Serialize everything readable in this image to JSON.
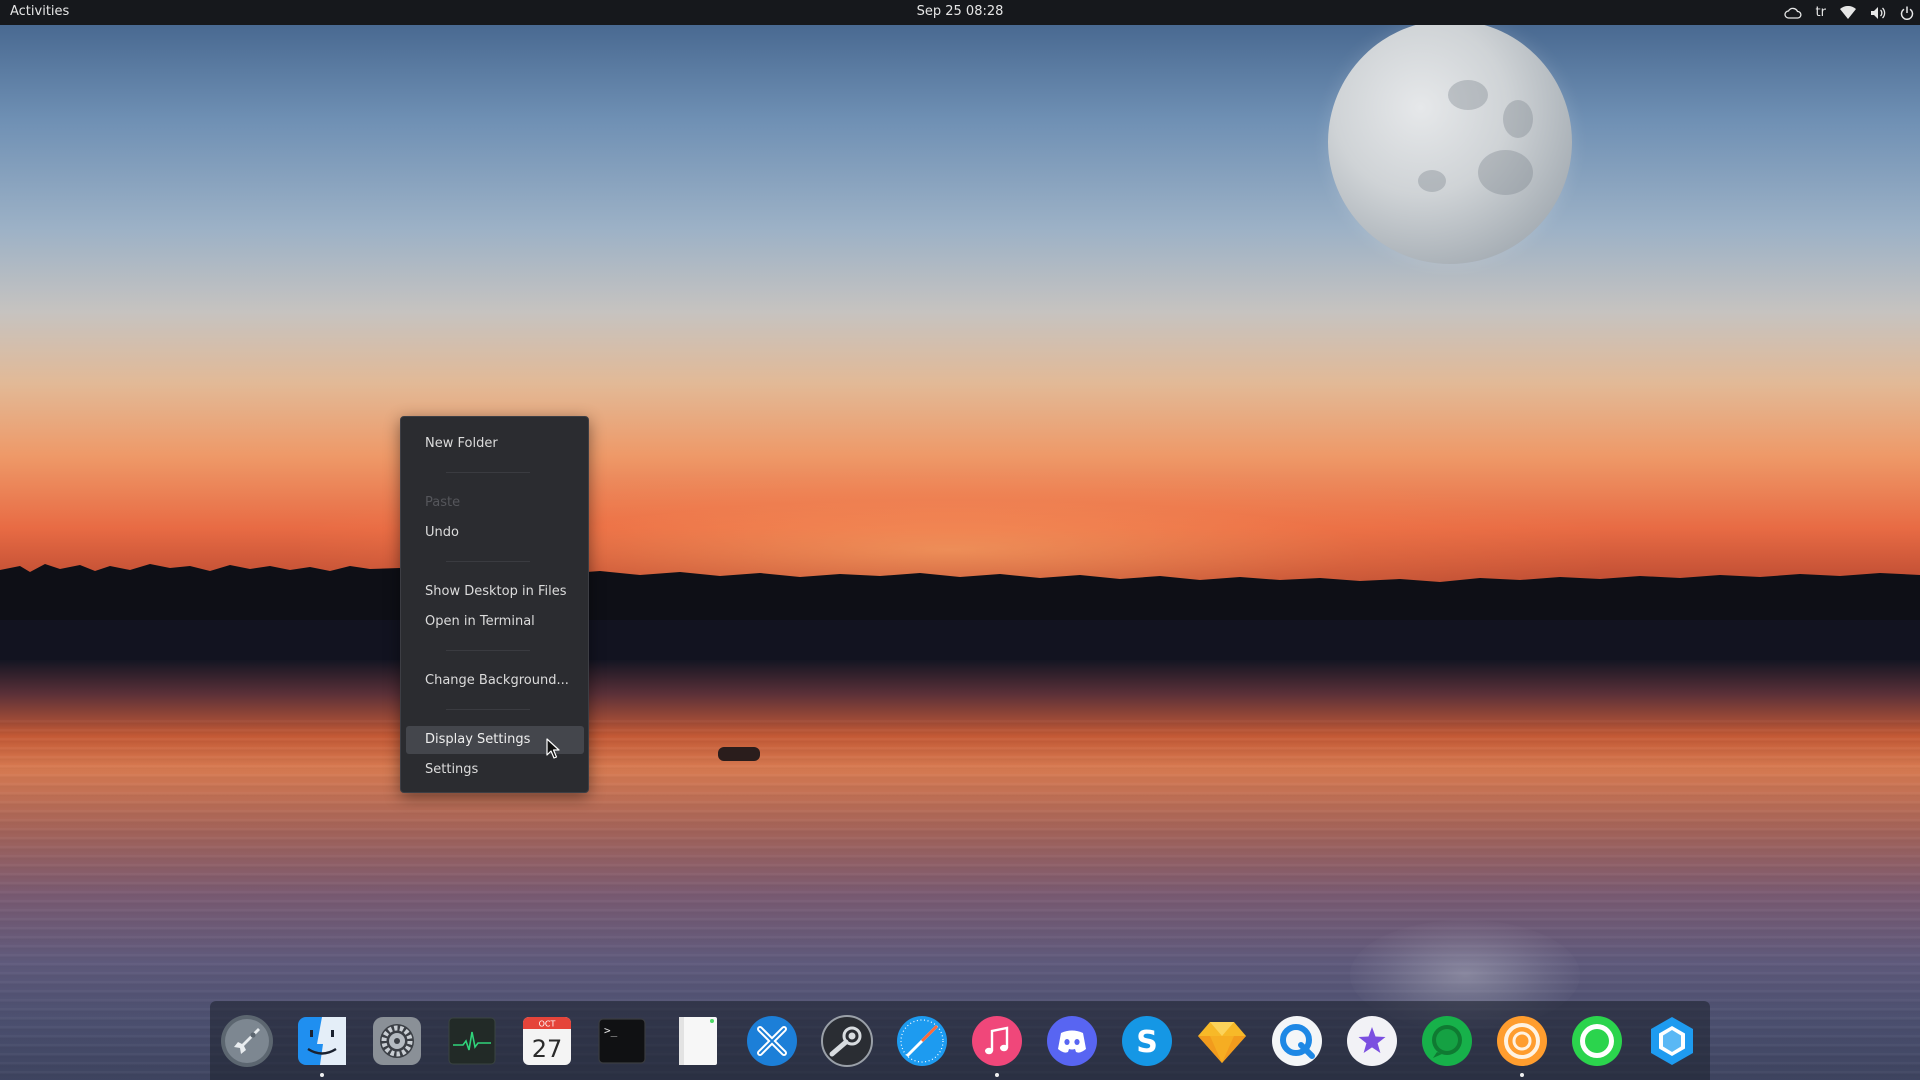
{
  "topbar": {
    "activities_label": "Activities",
    "clock": "Sep 25  08:28",
    "keyboard_layout": "tr",
    "tray_icons": [
      "cloud-icon",
      "keyboard-layout-indicator",
      "wifi-icon",
      "volume-icon",
      "power-icon"
    ]
  },
  "context_menu": {
    "items": [
      {
        "label": "New Folder",
        "state": "enabled"
      },
      {
        "label": "Paste",
        "state": "disabled"
      },
      {
        "label": "Undo",
        "state": "enabled"
      },
      {
        "label": "Show Desktop in Files",
        "state": "enabled"
      },
      {
        "label": "Open in Terminal",
        "state": "enabled"
      },
      {
        "label": "Change Background...",
        "state": "enabled"
      },
      {
        "label": "Display Settings",
        "state": "hovered"
      },
      {
        "label": "Settings",
        "state": "enabled"
      }
    ]
  },
  "dock": {
    "apps": [
      {
        "icon": "rocket-launcher-icon",
        "running": false
      },
      {
        "icon": "finder-files-icon",
        "running": true
      },
      {
        "icon": "system-settings-gear-icon",
        "running": false
      },
      {
        "icon": "system-monitor-icon",
        "running": false
      },
      {
        "icon": "calendar-icon",
        "running": false,
        "month": "OCT",
        "day": "27"
      },
      {
        "icon": "terminal-icon",
        "running": false,
        "prompt": ">_"
      },
      {
        "icon": "text-editor-icon",
        "running": false
      },
      {
        "icon": "xcode-x-icon",
        "running": false
      },
      {
        "icon": "steam-icon",
        "running": false
      },
      {
        "icon": "safari-compass-icon",
        "running": false
      },
      {
        "icon": "music-icon",
        "running": true
      },
      {
        "icon": "discord-icon",
        "running": false
      },
      {
        "icon": "skype-icon",
        "running": false,
        "glyph": "S"
      },
      {
        "icon": "sketch-diamond-icon",
        "running": false
      },
      {
        "icon": "quicktime-q-icon",
        "running": false
      },
      {
        "icon": "star-app-icon",
        "running": false
      },
      {
        "icon": "green-chat-icon",
        "running": false
      },
      {
        "icon": "orange-ring-icon",
        "running": true
      },
      {
        "icon": "green-circle-icon",
        "running": false
      },
      {
        "icon": "blue-hexagon-icon",
        "running": false
      }
    ]
  },
  "colors": {
    "topbar_bg": "#16181c",
    "menu_bg": "#2b2c30",
    "menu_hover": "#44464c",
    "dock_bg": "rgba(28,32,44,0.55)"
  }
}
